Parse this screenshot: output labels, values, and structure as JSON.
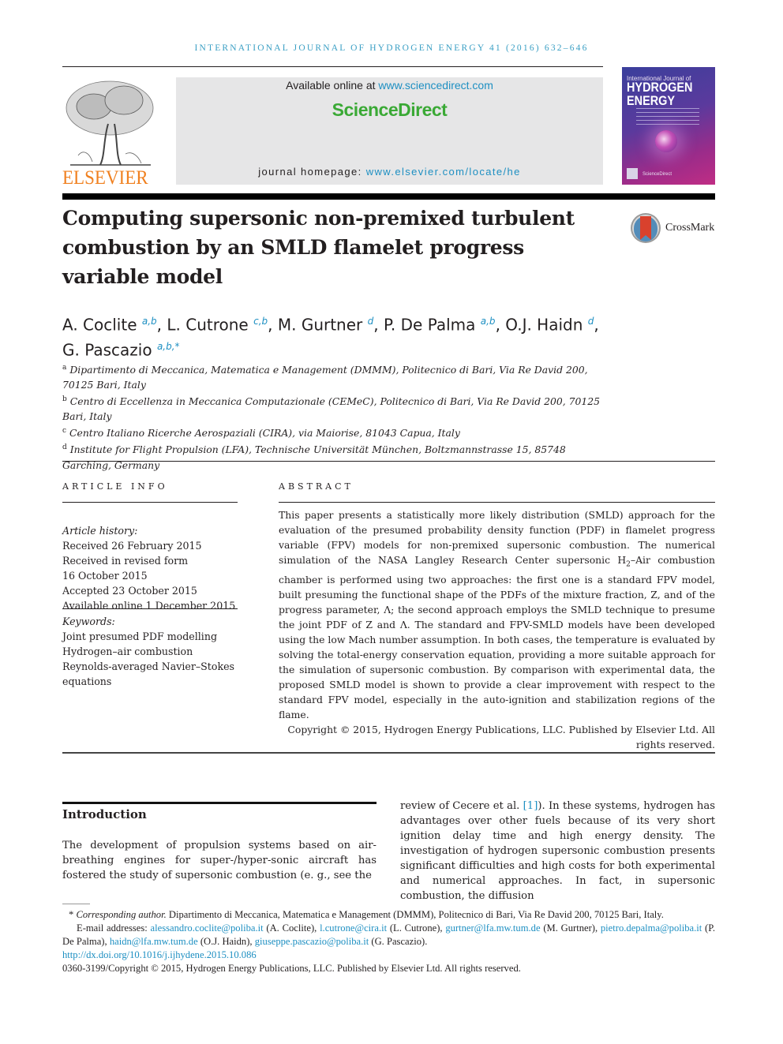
{
  "running_head": "INTERNATIONAL JOURNAL OF HYDROGEN ENERGY 41 (2016) 632–646",
  "header": {
    "publisher": "ELSEVIER",
    "available_prefix": "Available online at ",
    "available_link": "www.sciencedirect.com",
    "platform": "ScienceDirect",
    "homepage_prefix": "journal homepage: ",
    "homepage_link": "www.elsevier.com/locate/he",
    "cover": {
      "line1": "International Journal of",
      "line2": "HYDROGEN",
      "line3": "ENERGY",
      "footer": "ScienceDirect"
    },
    "crossmark": "CrossMark"
  },
  "article": {
    "title": "Computing supersonic non-premixed turbulent combustion by an SMLD flamelet progress variable model",
    "authors": [
      {
        "name": "A. Coclite",
        "sup": "a,b"
      },
      {
        "name": "L. Cutrone",
        "sup": "c,b"
      },
      {
        "name": "M. Gurtner",
        "sup": "d"
      },
      {
        "name": "P. De Palma",
        "sup": "a,b"
      },
      {
        "name": "O.J. Haidn",
        "sup": "d"
      },
      {
        "name": "G. Pascazio",
        "sup": "a,b,*"
      }
    ],
    "affiliations": [
      {
        "key": "a",
        "text": "Dipartimento di Meccanica, Matematica e Management (DMMM), Politecnico di Bari, Via Re David 200, 70125 Bari, Italy"
      },
      {
        "key": "b",
        "text": "Centro di Eccellenza in Meccanica Computazionale (CEMeC), Politecnico di Bari, Via Re David 200, 70125 Bari, Italy"
      },
      {
        "key": "c",
        "text": "Centro Italiano Ricerche Aerospaziali (CIRA), via Maiorise, 81043 Capua, Italy"
      },
      {
        "key": "d",
        "text": "Institute for Flight Propulsion (LFA), Technische Universität München, Boltzmannstrasse 15, 85748 Garching, Germany"
      }
    ]
  },
  "article_info": {
    "label": "ARTICLE INFO",
    "history_label": "Article history:",
    "history": [
      "Received 26 February 2015",
      "Received in revised form",
      "16 October 2015",
      "Accepted 23 October 2015",
      "Available online 1 December 2015"
    ],
    "keywords_label": "Keywords:",
    "keywords": [
      "Joint presumed PDF modelling",
      "Hydrogen–air combustion",
      "Reynolds-averaged Navier–Stokes",
      "equations"
    ]
  },
  "abstract": {
    "label": "ABSTRACT",
    "text_1": "This paper presents a statistically more likely distribution (SMLD) approach for the evaluation of the presumed probability density function (PDF) in flamelet progress variable (FPV) models for non-premixed supersonic combustion. The numerical simulation of the NASA Langley Research Center supersonic H",
    "text_sub": "2",
    "text_2": "–Air combustion chamber is performed using two approaches: the first one is a standard FPV model, built presuming the functional shape of the PDFs of the mixture fraction, Z, and of the progress parameter, Λ; the second approach employs the SMLD technique to presume the joint PDF of Z and Λ. The standard and FPV-SMLD models have been developed using the low Mach number assumption. In both cases, the temperature is evaluated by solving the total-energy conservation equation, providing a more suitable approach for the simulation of supersonic combustion. By comparison with experimental data, the proposed SMLD model is shown to provide a clear improvement with respect to the standard FPV model, especially in the auto-ignition and stabilization regions of the flame.",
    "copyright": "Copyright © 2015, Hydrogen Energy Publications, LLC. Published by Elsevier Ltd. All rights reserved."
  },
  "introduction": {
    "heading": "Introduction",
    "left_text": "The development of propulsion systems based on air-breathing engines for super-/hyper-sonic aircraft has fostered the study of supersonic combustion (e. g., see the",
    "right_text_1": "review of Cecere et al. ",
    "ref": "[1]",
    "right_text_2": "). In these systems, hydrogen has advantages over other fuels because of its very short ignition delay time and high energy density. The investigation of hydrogen supersonic combustion presents significant difficulties and high costs for both experimental and numerical approaches. In fact, in supersonic combustion, the diffusion"
  },
  "footnotes": {
    "corresponding_label": "Corresponding author.",
    "corresponding_text": " Dipartimento di Meccanica, Matematica e Management (DMMM), Politecnico di Bari, Via Re David 200, 70125 Bari, Italy.",
    "email_label": "E-mail addresses: ",
    "emails": [
      {
        "address": "alessandro.coclite@poliba.it",
        "name": " (A. Coclite), "
      },
      {
        "address": "l.cutrone@cira.it",
        "name": " (L. Cutrone), "
      },
      {
        "address": "gurtner@lfa.mw.tum.de",
        "name": " (M. Gurtner), "
      },
      {
        "address": "pietro.depalma@poliba.it",
        "name": " (P. De Palma), "
      },
      {
        "address": "haidn@lfa.mw.tum.de",
        "name": " (O.J. Haidn), "
      },
      {
        "address": "giuseppe.pascazio@poliba.it",
        "name": " (G. Pascazio)."
      }
    ],
    "doi": "http://dx.doi.org/10.1016/j.ijhydene.2015.10.086",
    "issn_copyright": "0360-3199/Copyright © 2015, Hydrogen Energy Publications, LLC. Published by Elsevier Ltd. All rights reserved."
  },
  "colors": {
    "link": "#1d8fc2",
    "running_head": "#3a9fc4",
    "elsevier_orange": "#f0801f",
    "sciencedirect_green": "#3aa935",
    "header_box": "#e6e6e7"
  }
}
